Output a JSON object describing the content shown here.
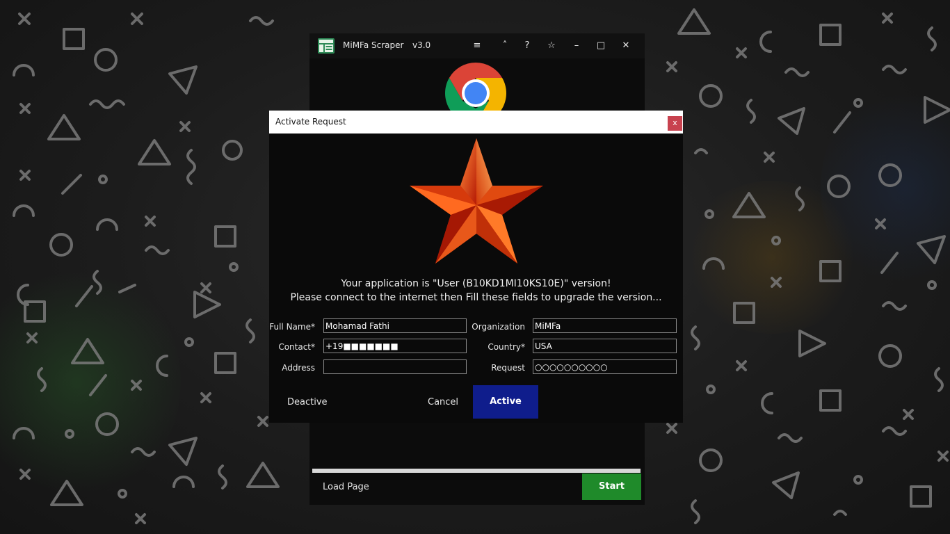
{
  "app": {
    "title": "MiMFa Scraper",
    "version": "v3.0",
    "toolbar": {
      "menu_icon": "≡",
      "up_icon": "˄",
      "help_icon": "?",
      "star_icon": "☆",
      "minimize_icon": "–",
      "maximize_icon": "□",
      "close_icon": "✕"
    },
    "footer": {
      "load_label": "Load Page",
      "start_label": "Start"
    },
    "colors": {
      "start": "#1f8a2a",
      "active": "#0f1d8c",
      "close": "#c8424f"
    }
  },
  "dialog": {
    "title": "Activate Request",
    "close_label": "x",
    "message_line1": "Your application is \"User (B10KD1MI10KS10E)\" version!",
    "message_line2": "Please connect to the internet then Fill these fields to upgrade the version...",
    "fields": {
      "full_name": {
        "label": "Full Name*",
        "value": "Mohamad Fathi"
      },
      "contact": {
        "label": "Contact*",
        "value": "+19■■■■■■■"
      },
      "address": {
        "label": "Address",
        "value": ""
      },
      "organization": {
        "label": "Organization",
        "value": "MiMFa"
      },
      "country": {
        "label": "Country*",
        "value": "USA"
      },
      "request": {
        "label": "Request",
        "value": "○○○○○○○○○○"
      }
    },
    "buttons": {
      "deactive": "Deactive",
      "cancel": "Cancel",
      "active": "Active"
    }
  }
}
